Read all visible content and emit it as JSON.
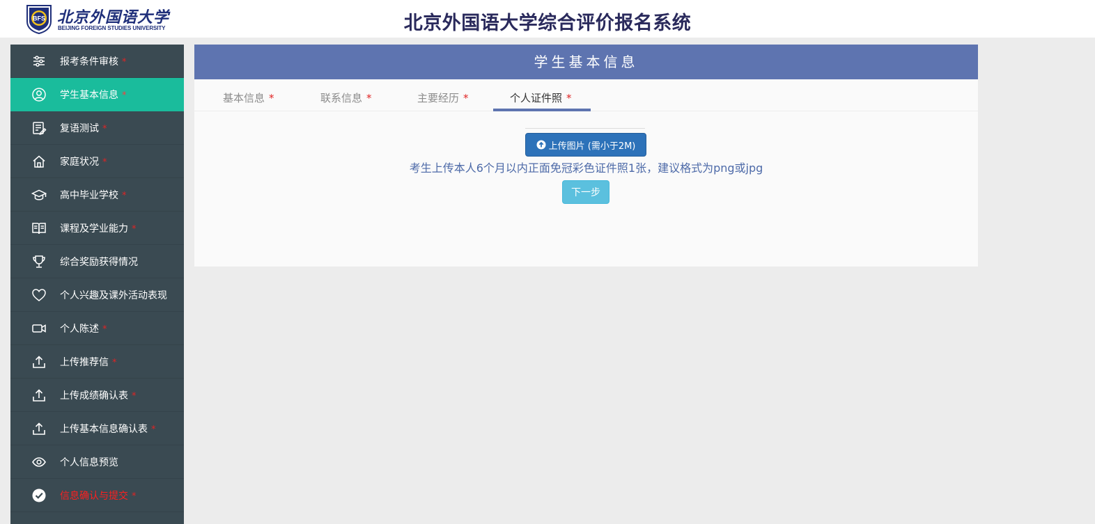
{
  "header": {
    "logo_cn": "北京外国语大学",
    "logo_en": "BEIJING FOREIGN STUDIES UNIVERSITY",
    "logo_seal_text": "BFS",
    "title": "北京外国语大学综合评价报名系统"
  },
  "sidebar": {
    "items": [
      {
        "label": "报考条件审核",
        "required": "*",
        "icon": "sliders-icon"
      },
      {
        "label": "学生基本信息",
        "required": "*",
        "icon": "user-icon",
        "active": true
      },
      {
        "label": "复语测试",
        "required": "*",
        "icon": "edit-document-icon"
      },
      {
        "label": "家庭状况",
        "required": "*",
        "icon": "home-icon"
      },
      {
        "label": "高中毕业学校",
        "required": "*",
        "icon": "graduation-cap-icon"
      },
      {
        "label": "课程及学业能力",
        "required": "*",
        "icon": "book-icon"
      },
      {
        "label": "综合奖励获得情况",
        "required": "",
        "icon": "trophy-icon"
      },
      {
        "label": "个人兴趣及课外活动表现",
        "required": "",
        "icon": "heart-icon"
      },
      {
        "label": "个人陈述",
        "required": "*",
        "icon": "video-icon"
      },
      {
        "label": "上传推荐信",
        "required": "*",
        "icon": "upload-icon"
      },
      {
        "label": "上传成绩确认表",
        "required": "*",
        "icon": "upload-icon"
      },
      {
        "label": "上传基本信息确认表",
        "required": "*",
        "icon": "upload-icon"
      },
      {
        "label": "个人信息预览",
        "required": "",
        "icon": "eye-icon"
      },
      {
        "label": "信息确认与提交",
        "required": "*",
        "icon": "check-circle-icon",
        "danger": true
      }
    ]
  },
  "panel": {
    "title": "学生基本信息",
    "tabs": [
      {
        "label": "基本信息",
        "required": "*"
      },
      {
        "label": "联系信息",
        "required": "*"
      },
      {
        "label": "主要经历",
        "required": "*"
      },
      {
        "label": "个人证件照",
        "required": "*",
        "active": true
      }
    ],
    "upload_button": "上传图片 (需小于2M)",
    "hint": "考生上传本人6个月以内正面免冠彩色证件照1张，建议格式为png或jpg",
    "next_button": "下一步"
  },
  "colors": {
    "sidebar_bg": "#3a4a52",
    "sidebar_active": "#1abc9c",
    "panel_header": "#5e74b0",
    "upload_button": "#2d72b9",
    "next_button": "#5bc0de",
    "required_mark": "#e02424"
  }
}
